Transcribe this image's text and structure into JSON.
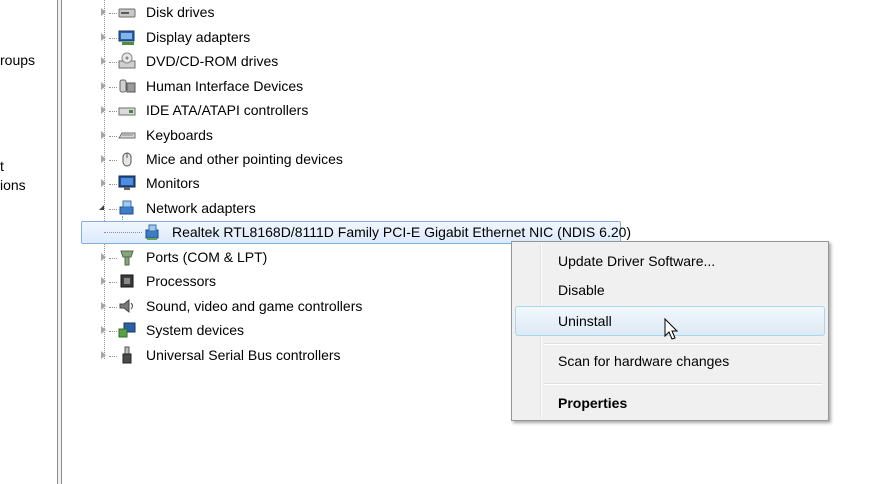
{
  "left_pane": {
    "fragments": [
      "roups",
      "t",
      "ions"
    ]
  },
  "tree": {
    "items": [
      {
        "label": "Disk drives",
        "icon": "disk-drive-icon"
      },
      {
        "label": "Display adapters",
        "icon": "display-adapter-icon"
      },
      {
        "label": "DVD/CD-ROM drives",
        "icon": "dvd-drive-icon"
      },
      {
        "label": "Human Interface Devices",
        "icon": "hid-icon"
      },
      {
        "label": "IDE ATA/ATAPI controllers",
        "icon": "ide-controller-icon"
      },
      {
        "label": "Keyboards",
        "icon": "keyboard-icon"
      },
      {
        "label": "Mice and other pointing devices",
        "icon": "mouse-icon"
      },
      {
        "label": "Monitors",
        "icon": "monitor-icon"
      },
      {
        "label": "Network adapters",
        "icon": "network-adapter-icon",
        "expanded": true
      },
      {
        "label": "Ports (COM & LPT)",
        "icon": "port-icon"
      },
      {
        "label": "Processors",
        "icon": "processor-icon"
      },
      {
        "label": "Sound, video and game controllers",
        "icon": "sound-icon"
      },
      {
        "label": "System devices",
        "icon": "system-device-icon"
      },
      {
        "label": "Universal Serial Bus controllers",
        "icon": "usb-icon"
      }
    ],
    "selected_child": {
      "label": "Realtek RTL8168D/8111D Family PCI-E Gigabit Ethernet NIC (NDIS 6.20)",
      "icon": "network-card-icon"
    }
  },
  "context_menu": {
    "items": [
      {
        "label": "Update Driver Software...",
        "bold": false
      },
      {
        "label": "Disable",
        "bold": false
      },
      {
        "label": "Uninstall",
        "bold": false,
        "highlighted": true
      },
      {
        "label": "Scan for hardware changes",
        "bold": false
      },
      {
        "label": "Properties",
        "bold": true
      }
    ]
  },
  "colors": {
    "selection_border": "#84acdd",
    "menu_background": "#f0f0f0",
    "hover_border": "#a8d8eb"
  }
}
